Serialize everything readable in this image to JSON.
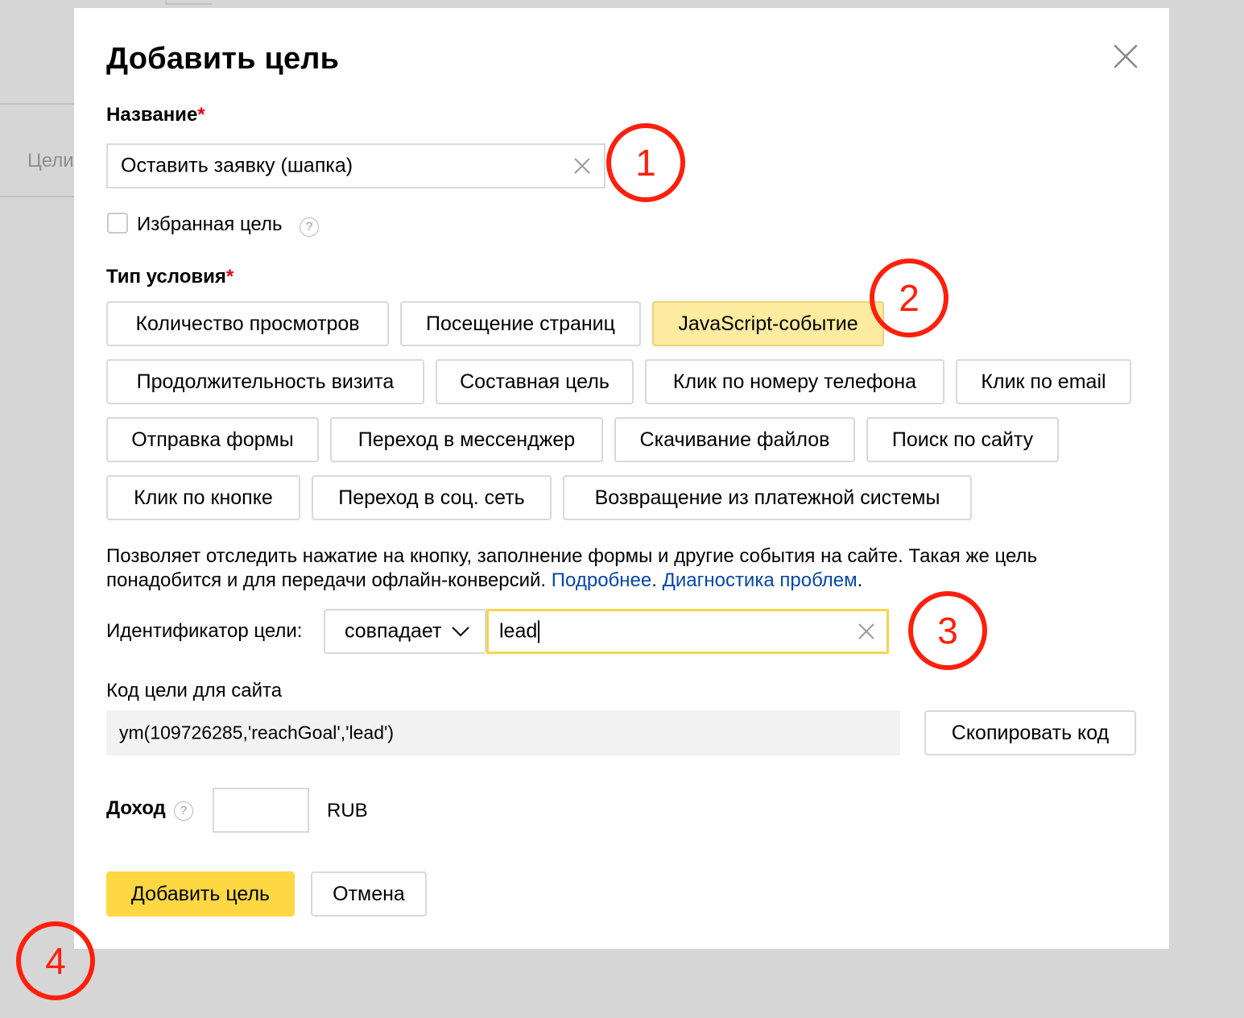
{
  "background": {
    "tab_label": "Цели"
  },
  "modal": {
    "title": "Добавить цель",
    "close_icon": "close-icon",
    "name_field": {
      "label": "Название",
      "required_mark": "*",
      "value": "Оставить заявку (шапка)"
    },
    "favorite": {
      "label": "Избранная цель",
      "checked": false,
      "help_glyph": "?"
    },
    "condition_type": {
      "label": "Тип условия",
      "required_mark": "*",
      "options": [
        "Количество просмотров",
        "Посещение страниц",
        "JavaScript-событие",
        "Продолжительность визита",
        "Составная цель",
        "Клик по номеру телефона",
        "Клик по email",
        "Отправка формы",
        "Переход в мессенджер",
        "Скачивание файлов",
        "Поиск по сайту",
        "Клик по кнопке",
        "Переход в соц. сеть",
        "Возвращение из платежной системы"
      ],
      "selected": "JavaScript-событие"
    },
    "description": {
      "text": "Позволяет отследить нажатие на кнопку, заполнение формы и другие события на сайте. Такая же цель понадобится и для передачи офлайн-конверсий. ",
      "link_more": "Подробнее",
      "separator": ". ",
      "link_diagnostics": "Диагностика проблем",
      "end": "."
    },
    "goal_id": {
      "label": "Идентификатор цели:",
      "match_select": "совпадает",
      "value": "lead"
    },
    "site_code": {
      "label": "Код цели для сайта",
      "code": "ym(109726285,'reachGoal','lead')",
      "copy_button": "Скопировать код"
    },
    "income": {
      "label": "Доход",
      "help_glyph": "?",
      "value": "",
      "currency": "RUB"
    },
    "footer": {
      "submit": "Добавить цель",
      "cancel": "Отмена"
    }
  },
  "annotations": {
    "markers": [
      "1",
      "2",
      "3",
      "4"
    ],
    "color": "#ff1f0b"
  },
  "colors": {
    "accent_yellow": "#fdd843",
    "selected_chip": "#fdeb9f",
    "link_blue": "#0645ad",
    "required_red": "#e8000b"
  }
}
